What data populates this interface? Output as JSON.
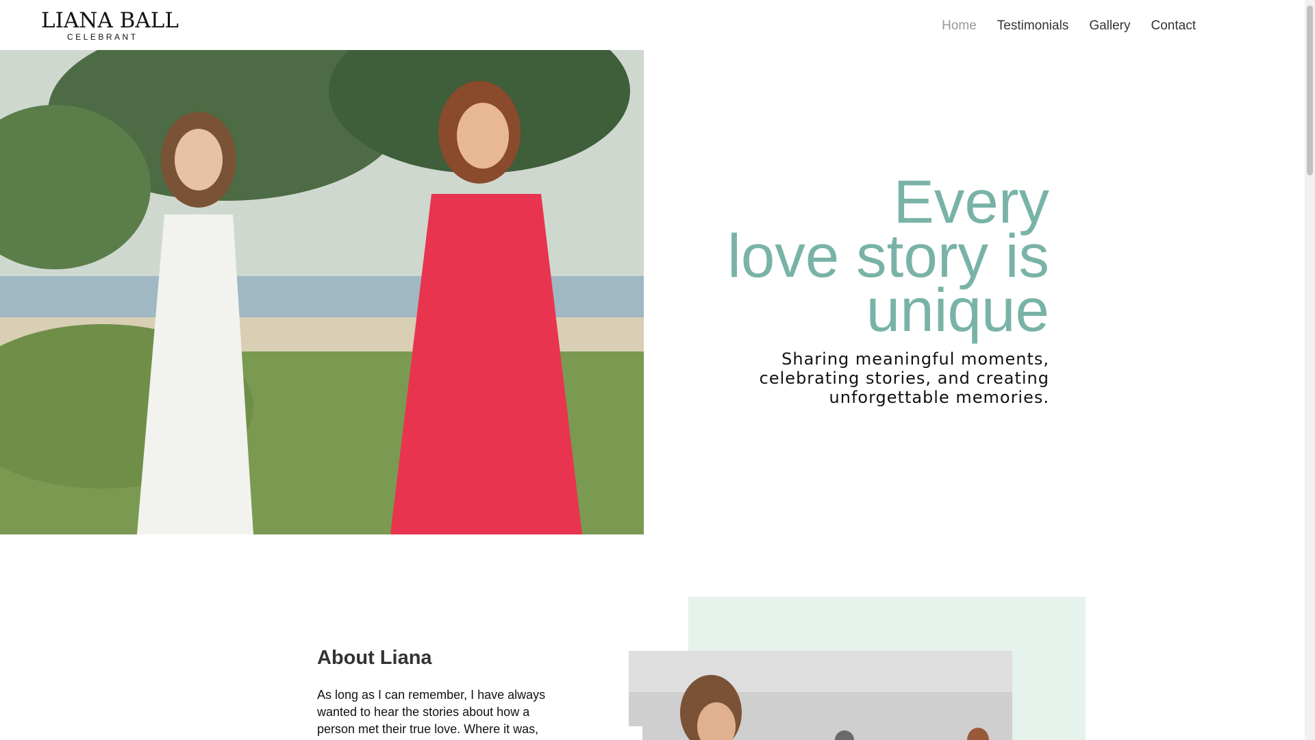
{
  "header": {
    "logo_main": "LIANA BALL",
    "logo_sub": "CELEBRANT",
    "nav": [
      {
        "label": "Home",
        "active": true
      },
      {
        "label": "Testimonials",
        "active": false
      },
      {
        "label": "Gallery",
        "active": false
      },
      {
        "label": "Contact",
        "active": false
      }
    ]
  },
  "hero": {
    "title_line1": "Every",
    "title_line2": "love story is",
    "title_line3": "unique",
    "subtitle_line1": "Sharing meaningful moments,",
    "subtitle_line2": "celebrating stories, and creating",
    "subtitle_line3": "unforgettable memories."
  },
  "about": {
    "title": "About Liana",
    "body": "As long as I can remember, I have always wanted to hear the stories about how a person met their true love. Where it was,"
  },
  "colors": {
    "accent": "#79b3a8",
    "mint": "#e6f2ec",
    "nav_active": "#999999"
  }
}
